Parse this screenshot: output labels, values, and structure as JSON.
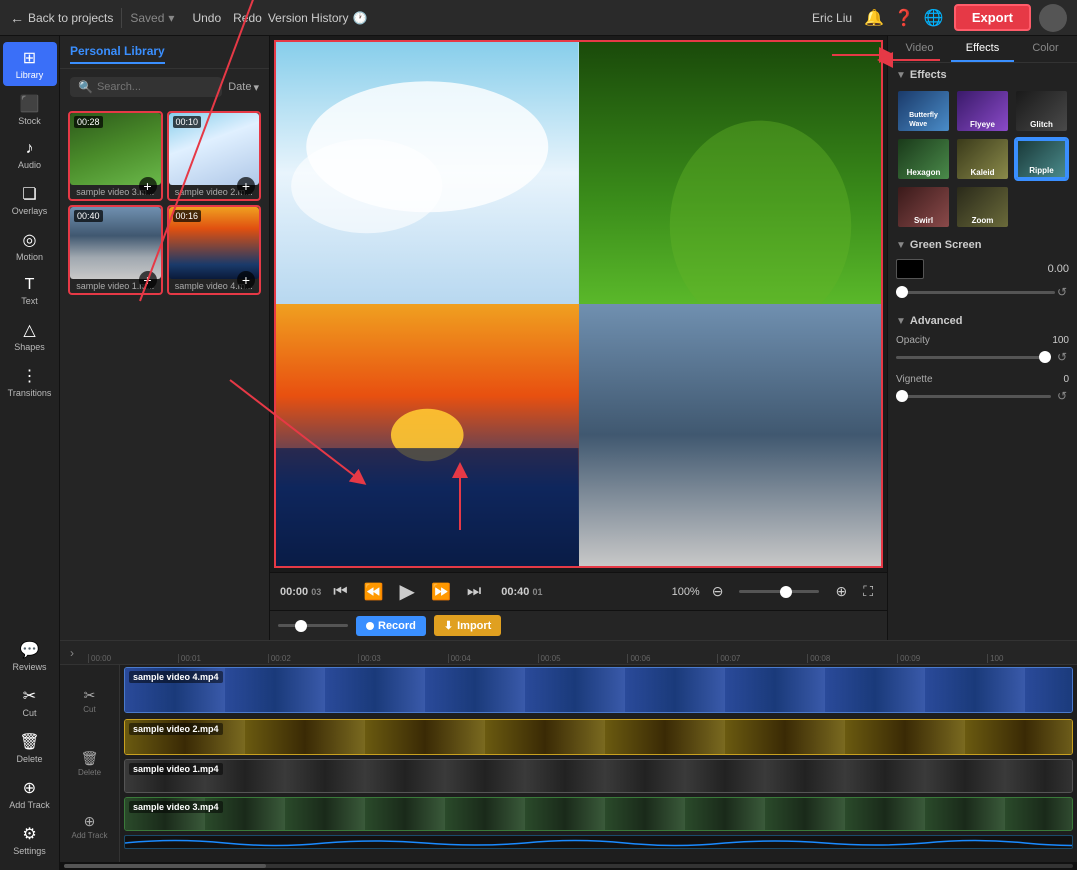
{
  "topbar": {
    "back_label": "Back to projects",
    "saved_label": "Saved",
    "undo_label": "Undo",
    "redo_label": "Redo",
    "history_label": "Version History",
    "user_label": "Eric Liu",
    "export_label": "Export"
  },
  "sidebar": {
    "items": [
      {
        "id": "library",
        "label": "Library",
        "icon": "⊞",
        "active": true
      },
      {
        "id": "stock",
        "label": "Stock",
        "icon": "⬛"
      },
      {
        "id": "audio",
        "label": "Audio",
        "icon": "♪"
      },
      {
        "id": "overlays",
        "label": "Overlays",
        "icon": "❏"
      },
      {
        "id": "motion",
        "label": "Motion",
        "icon": "◎"
      },
      {
        "id": "text",
        "label": "Text",
        "icon": "T"
      },
      {
        "id": "shapes",
        "label": "Shapes",
        "icon": "△"
      },
      {
        "id": "transitions",
        "label": "Transitions",
        "icon": "⋮"
      }
    ],
    "bottom": [
      {
        "id": "reviews",
        "label": "Reviews",
        "icon": "💬"
      },
      {
        "id": "cut",
        "label": "Cut",
        "icon": "✂"
      },
      {
        "id": "delete",
        "label": "Delete",
        "icon": "🗑"
      },
      {
        "id": "add-track",
        "label": "Add Track",
        "icon": "⊕"
      },
      {
        "id": "settings",
        "label": "Settings",
        "icon": "⚙"
      }
    ]
  },
  "library": {
    "tab_label": "Personal Library",
    "search_placeholder": "Search...",
    "date_filter": "Date",
    "thumbnails": [
      {
        "name": "sample video 3.m...",
        "duration": "00:28",
        "selected": false
      },
      {
        "name": "sample video 2.m...",
        "duration": "00:10",
        "selected": false
      },
      {
        "name": "sample video 1.m...",
        "duration": "00:40",
        "selected": false
      },
      {
        "name": "sample video 4.m...",
        "duration": "00:16",
        "selected": false
      }
    ]
  },
  "controls": {
    "time_current": "00:00",
    "time_sub": "03",
    "time_total": "00:40",
    "time_total_sub": "01",
    "zoom_level": "100%",
    "record_label": "Record",
    "import_label": "Import"
  },
  "right_panel": {
    "tabs": [
      "Video",
      "Effects",
      "Color"
    ],
    "active_tab": "Effects",
    "effects": {
      "section_label": "Effects",
      "items": [
        {
          "id": "butterfly-wave",
          "label": "Butterfly Wave",
          "style": "butterfly"
        },
        {
          "id": "flyeye",
          "label": "Flyeye",
          "style": "flyeye"
        },
        {
          "id": "glitch",
          "label": "Glitch",
          "style": "glitch"
        },
        {
          "id": "hexagon",
          "label": "Hexagon",
          "style": "hexagon"
        },
        {
          "id": "kaleid",
          "label": "Kaleid",
          "style": "kaleid"
        },
        {
          "id": "ripple",
          "label": "Ripple",
          "style": "ripple",
          "selected": true
        },
        {
          "id": "swirl",
          "label": "Swirl",
          "style": "swirl"
        },
        {
          "id": "zoom",
          "label": "Zoom",
          "style": "zoom"
        }
      ]
    },
    "green_screen": {
      "section_label": "Green Screen",
      "value": "0.00"
    },
    "advanced": {
      "section_label": "Advanced",
      "opacity_label": "Opacity",
      "opacity_value": "100",
      "vignette_label": "Vignette",
      "vignette_value": "0"
    }
  },
  "timeline": {
    "ruler_marks": [
      "00:00",
      "00:01",
      "00:02",
      "00:03",
      "00:04",
      "00:05",
      "00:06",
      "00:07",
      "00:08",
      "00:09",
      "100"
    ],
    "tracks": [
      {
        "id": "track1",
        "name": "sample video 4.mp4",
        "style": "track1"
      },
      {
        "id": "track2",
        "name": "sample video 2.mp4",
        "style": "track2"
      },
      {
        "id": "track3",
        "name": "sample video 1.mp4",
        "style": "track3"
      },
      {
        "id": "track4",
        "name": "sample video 3.mp4",
        "style": "track4"
      }
    ]
  }
}
